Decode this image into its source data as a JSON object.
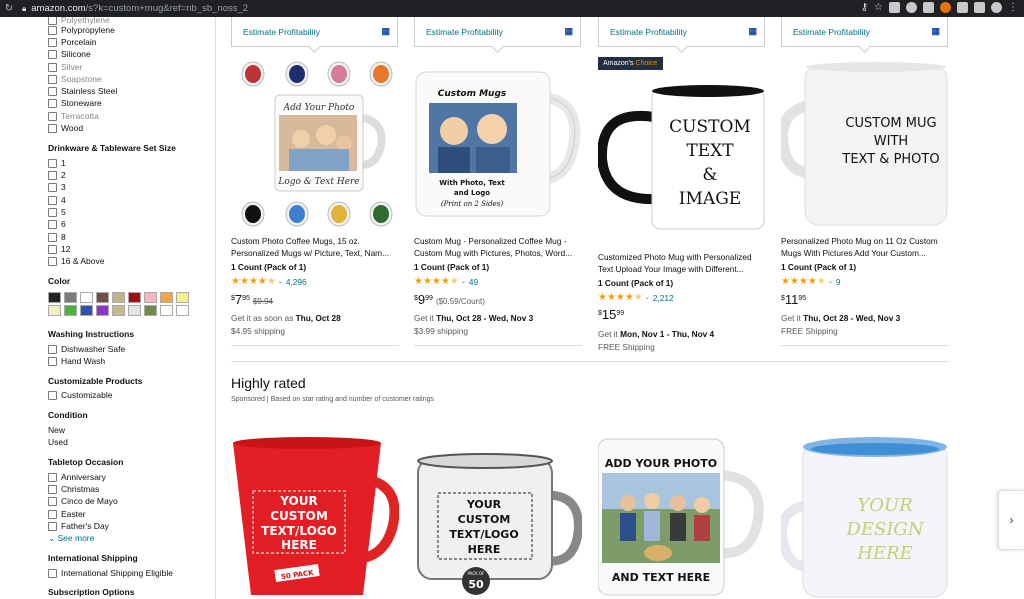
{
  "browser": {
    "url_host": "amazon.com",
    "url_path": "/s?k=custom+mug&ref=nb_sb_noss_2"
  },
  "sidebar": {
    "materials": [
      {
        "label": "Polyethylene",
        "muted": true
      },
      {
        "label": "Polypropylene",
        "muted": false
      },
      {
        "label": "Porcelain",
        "muted": false
      },
      {
        "label": "Silicone",
        "muted": false
      },
      {
        "label": "Silver",
        "muted": true
      },
      {
        "label": "Soapstone",
        "muted": true
      },
      {
        "label": "Stainless Steel",
        "muted": false
      },
      {
        "label": "Stoneware",
        "muted": false
      },
      {
        "label": "Terracotta",
        "muted": true
      },
      {
        "label": "Wood",
        "muted": false
      }
    ],
    "set_size": {
      "heading": "Drinkware & Tableware Set Size",
      "options": [
        "1",
        "2",
        "3",
        "4",
        "5",
        "6",
        "8",
        "12",
        "16 & Above"
      ]
    },
    "color": {
      "heading": "Color",
      "swatches": [
        "#222222",
        "#7c7c7c",
        "#ffffff",
        "#6e5047",
        "#c2b390",
        "#a40e0e",
        "#f6b6bf",
        "#f7a348",
        "#f8ef8f",
        "#f3efc2",
        "#4bb23b",
        "#2e54a8",
        "#8e34c8",
        "#c8b98a",
        "#e4e4e4",
        "#6d8d4a",
        "#ffffff",
        "#ffffff"
      ]
    },
    "washing": {
      "heading": "Washing Instructions",
      "options": [
        "Dishwasher Safe",
        "Hand Wash"
      ]
    },
    "customizable": {
      "heading": "Customizable Products",
      "options": [
        "Customizable"
      ]
    },
    "condition": {
      "heading": "Condition",
      "options": [
        "New",
        "Used"
      ]
    },
    "occasion": {
      "heading": "Tabletop Occasion",
      "options": [
        "Anniversary",
        "Christmas",
        "Cinco de Mayo",
        "Easter",
        "Father's Day"
      ],
      "see_more": "See more"
    },
    "shipping": {
      "heading": "International Shipping",
      "options": [
        "International Shipping Eligible"
      ]
    },
    "subscription": {
      "heading": "Subscription Options"
    }
  },
  "estimate_label": "Estimate Profitability",
  "products": [
    {
      "title": "Custom Photo Coffee Mugs, 15 oz. Personalized Mugs w/ Picture, Text, Nam...",
      "count": "1 Count (Pack of 1)",
      "rating": 4.5,
      "reviews": "4,296",
      "price_sym": "$",
      "price_whole": "7",
      "price_frac": "95",
      "list_price": "$9.94",
      "unit_price": "",
      "delivery_prefix": "Get it as soon as ",
      "delivery_date": "Thu, Oct 28",
      "shipping": "$4.95 shipping",
      "badge": false,
      "img_text": [
        "Add Your Photo",
        "Logo & Text Here"
      ]
    },
    {
      "title": "Custom Mug - Personalized Coffee Mug - Custom Mug with Pictures, Photos, Word...",
      "count": "1 Count (Pack of 1)",
      "rating": 4.5,
      "reviews": "49",
      "price_sym": "$",
      "price_whole": "9",
      "price_frac": "99",
      "list_price": "",
      "unit_price": "($0.59/Count)",
      "delivery_prefix": "Get it ",
      "delivery_date": "Thu, Oct 28 - Wed, Nov 3",
      "shipping": "$3.99 shipping",
      "badge": false,
      "img_text": [
        "Custom Mugs",
        "With Photo, Text",
        "and Logo",
        "(Print on 2 Sides)"
      ]
    },
    {
      "title": "Customized Photo Mug with Personalized Text Upload Your Image with Different...",
      "count": "1 Count (Pack of 1)",
      "rating": 4.5,
      "reviews": "2,212",
      "price_sym": "$",
      "price_whole": "15",
      "price_frac": "99",
      "list_price": "",
      "unit_price": "",
      "delivery_prefix": "Get it ",
      "delivery_date": "Mon, Nov 1 - Thu, Nov 4",
      "shipping": "FREE Shipping",
      "badge": true,
      "badge_a": "Amazon's",
      "badge_b": "Choice",
      "img_text": [
        "CUSTOM",
        "TEXT",
        "&",
        "IMAGE"
      ]
    },
    {
      "title": "Personalized Photo Mug on 11 Oz Custom Mugs With Pictures Add Your Custom...",
      "count": "1 Count (Pack of 1)",
      "rating": 4.5,
      "reviews": "9",
      "price_sym": "$",
      "price_whole": "11",
      "price_frac": "95",
      "list_price": "",
      "unit_price": "",
      "delivery_prefix": "Get it ",
      "delivery_date": "Thu, Oct 28 - Wed, Nov 3",
      "shipping": "FREE Shipping",
      "badge": false,
      "img_text": [
        "CUSTOM MUG",
        "WITH",
        "TEXT & PHOTO"
      ]
    }
  ],
  "highly_rated": {
    "title": "Highly rated",
    "subtitle": "Sponsored | Based on star rating and number of customer ratings",
    "mug1_text": [
      "YOUR",
      "CUSTOM",
      "TEXT/LOGO",
      "HERE",
      "50 PACK"
    ],
    "mug2_text": [
      "YOUR",
      "CUSTOM",
      "TEXT/LOGO",
      "HERE",
      "PACK OF",
      "50"
    ],
    "mug3_text": [
      "ADD YOUR PHOTO",
      "AND TEXT HERE"
    ],
    "mug4_text": [
      "YOUR",
      "DESIGN",
      "HERE"
    ]
  }
}
